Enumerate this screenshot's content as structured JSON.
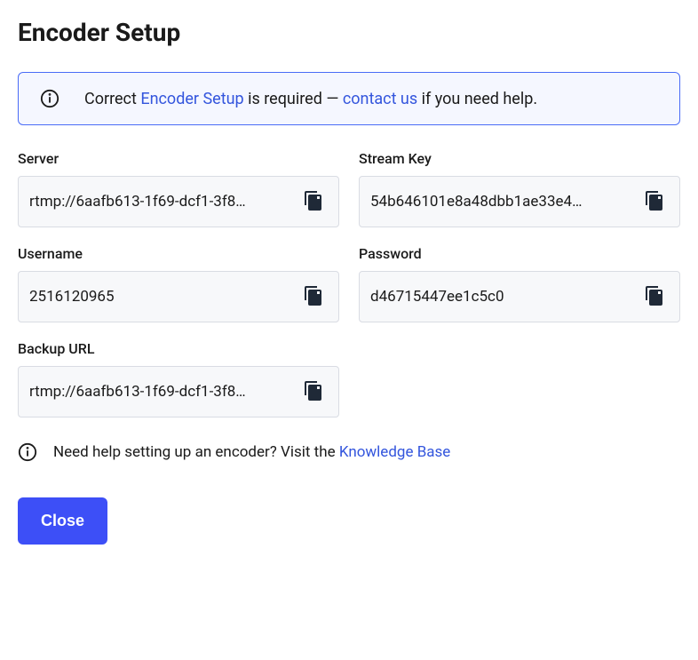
{
  "title": "Encoder Setup",
  "banner": {
    "prefix": "Correct ",
    "link1_text": "Encoder Setup",
    "middle": " is required — ",
    "link2_text": "contact us",
    "suffix": " if you need help."
  },
  "fields": {
    "server": {
      "label": "Server",
      "value": "rtmp://6aafb613-1f69-dcf1-3f8…"
    },
    "stream_key": {
      "label": "Stream Key",
      "value": "54b646101e8a48dbb1ae33e4…"
    },
    "username": {
      "label": "Username",
      "value": "2516120965"
    },
    "password": {
      "label": "Password",
      "value": "d46715447ee1c5c0"
    },
    "backup_url": {
      "label": "Backup URL",
      "value": "rtmp://6aafb613-1f69-dcf1-3f8…"
    }
  },
  "help": {
    "prefix": "Need help setting up an encoder? Visit the ",
    "link_text": "Knowledge Base"
  },
  "close_label": "Close"
}
